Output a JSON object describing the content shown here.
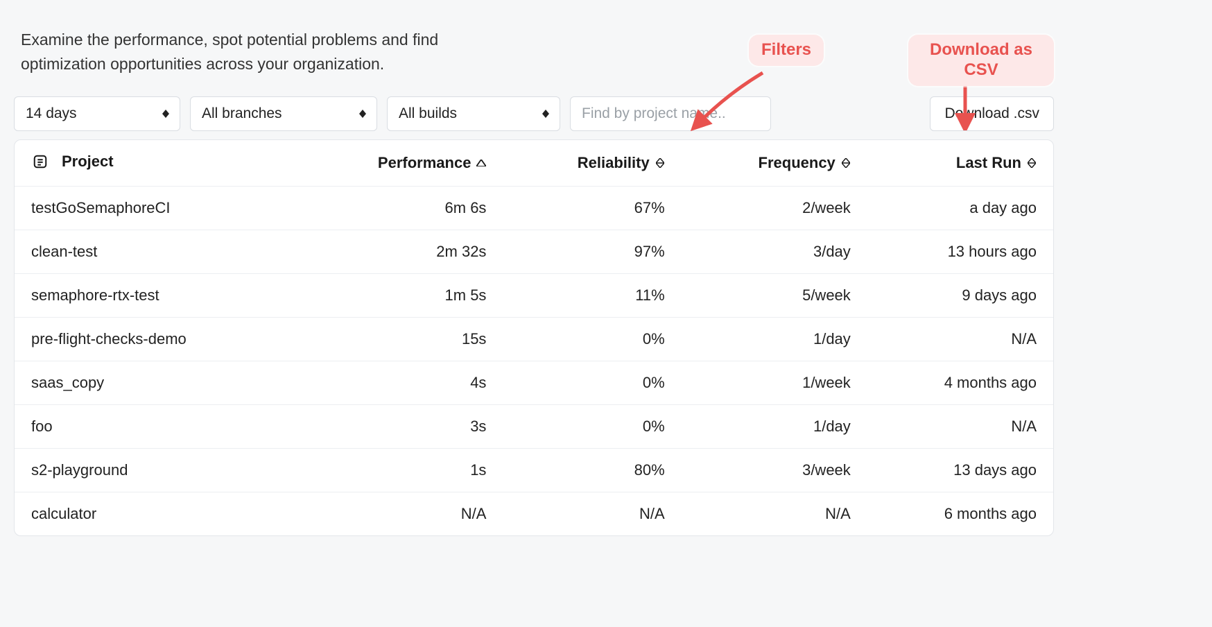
{
  "description": "Examine the performance, spot potential problems and find optimization opportunities across your organization.",
  "filters": {
    "time_range": "14 days",
    "branches": "All branches",
    "builds": "All builds",
    "search_placeholder": "Find by project name.."
  },
  "download_label": "Download .csv",
  "callouts": {
    "filters": "Filters",
    "download": "Download as CSV"
  },
  "columns": {
    "project": "Project",
    "performance": "Performance",
    "reliability": "Reliability",
    "frequency": "Frequency",
    "last_run": "Last Run"
  },
  "rows": [
    {
      "project": "testGoSemaphoreCI",
      "performance": "6m 6s",
      "reliability": "67%",
      "frequency": "2/week",
      "last_run": "a day ago"
    },
    {
      "project": "clean-test",
      "performance": "2m 32s",
      "reliability": "97%",
      "frequency": "3/day",
      "last_run": "13 hours ago"
    },
    {
      "project": "semaphore-rtx-test",
      "performance": "1m 5s",
      "reliability": "11%",
      "frequency": "5/week",
      "last_run": "9 days ago"
    },
    {
      "project": "pre-flight-checks-demo",
      "performance": "15s",
      "reliability": "0%",
      "frequency": "1/day",
      "last_run": "N/A"
    },
    {
      "project": "saas_copy",
      "performance": "4s",
      "reliability": "0%",
      "frequency": "1/week",
      "last_run": "4 months ago"
    },
    {
      "project": "foo",
      "performance": "3s",
      "reliability": "0%",
      "frequency": "1/day",
      "last_run": "N/A"
    },
    {
      "project": "s2-playground",
      "performance": "1s",
      "reliability": "80%",
      "frequency": "3/week",
      "last_run": "13 days ago"
    },
    {
      "project": "calculator",
      "performance": "N/A",
      "reliability": "N/A",
      "frequency": "N/A",
      "last_run": "6 months ago"
    }
  ]
}
